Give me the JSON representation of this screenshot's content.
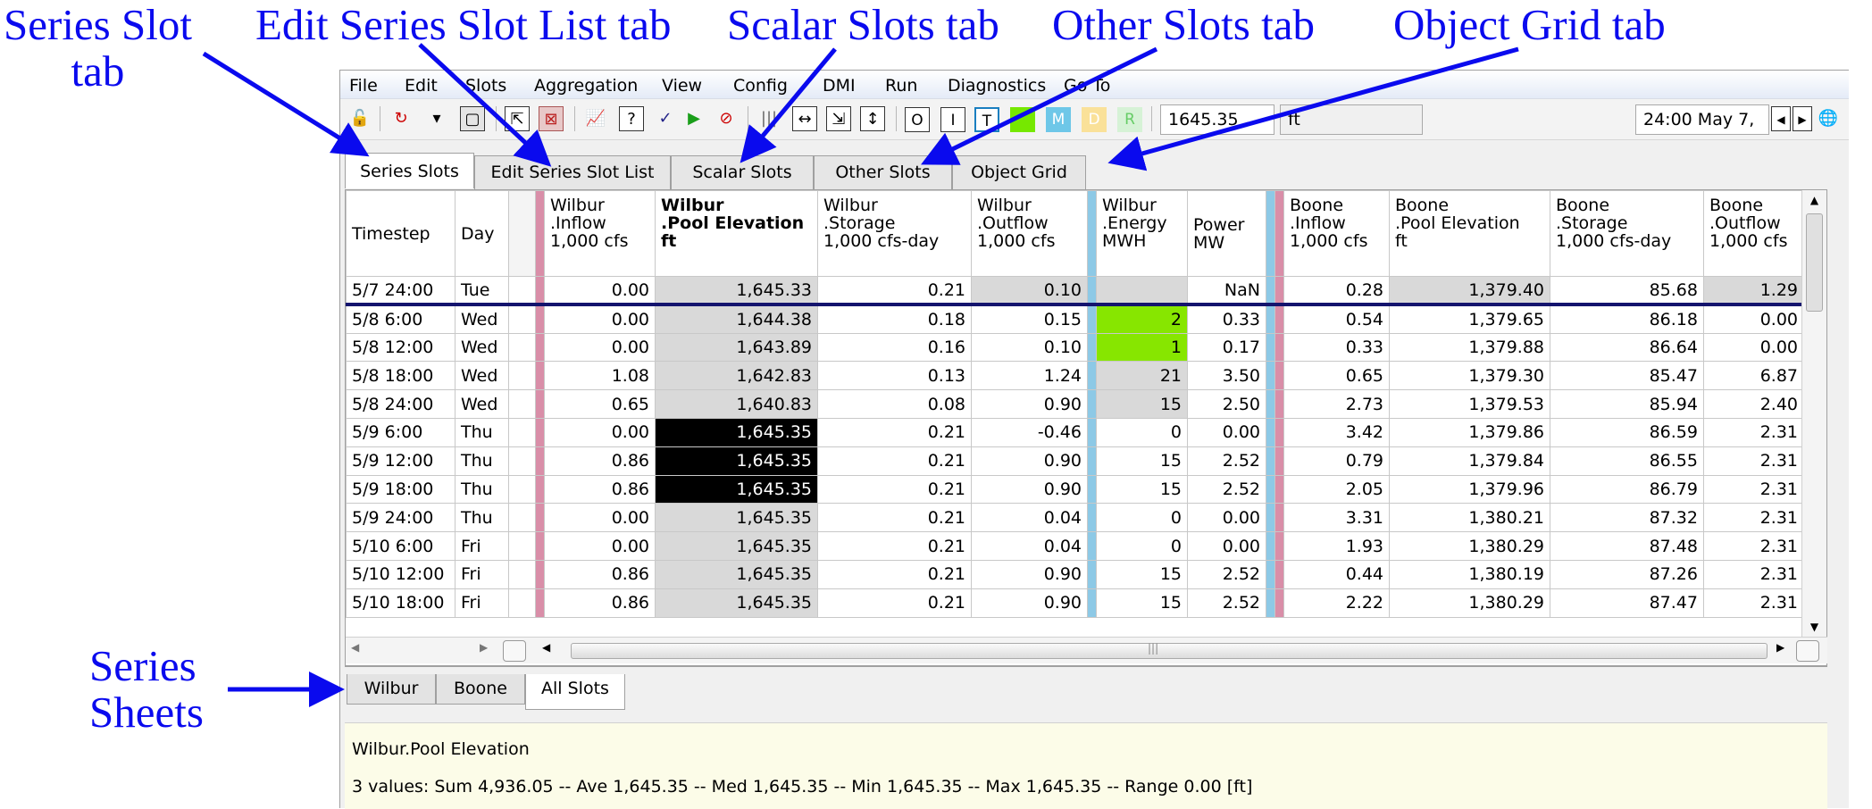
{
  "annotations": {
    "series_slot_tab": "Series Slot\ntab",
    "edit_list_tab": "Edit Series Slot List tab",
    "scalar_tab": "Scalar Slots tab",
    "other_tab": "Other Slots tab",
    "object_grid_tab": "Object Grid tab",
    "series_sheets": "Series\nSheets"
  },
  "menu": [
    "File",
    "Edit",
    "Slots",
    "Aggregation",
    "View",
    "Config",
    "DMI",
    "Run",
    "Diagnostics",
    "Go To"
  ],
  "toolbar": {
    "value": "1645.35",
    "unit": "ft",
    "date": "24:00 May 7,",
    "letters": [
      "O",
      "I",
      "T",
      "M",
      "D",
      "R"
    ]
  },
  "tabs": [
    "Series Slots",
    "Edit Series Slot List",
    "Scalar Slots",
    "Other Slots",
    "Object Grid"
  ],
  "left_headers": [
    "Timestep",
    "Day"
  ],
  "headers": [
    "Wilbur\n.Inflow\n1,000 cfs",
    "Wilbur\n.Pool Elevation\nft",
    "Wilbur\n.Storage\n1,000 cfs-day",
    "Wilbur\n.Outflow\n1,000 cfs",
    "Wilbur\n.Energy\nMWH",
    "Power\nMW",
    "Boone\n.Inflow\n1,000 cfs",
    "Boone\n.Pool Elevation\nft",
    "Boone\n.Storage\n1,000 cfs-day",
    "Boone\n.Outflow\n1,000 cfs"
  ],
  "rows": [
    {
      "t": "5/7 24:00",
      "d": "Tue",
      "v": [
        "0.00",
        "1,645.33",
        "0.21",
        "0.10",
        "",
        "NaN",
        "0.28",
        "1,379.40",
        "85.68",
        "1.29"
      ]
    },
    {
      "t": "5/8 6:00",
      "d": "Wed",
      "v": [
        "0.00",
        "1,644.38",
        "0.18",
        "0.15",
        "2",
        "0.33",
        "0.54",
        "1,379.65",
        "86.18",
        "0.00"
      ]
    },
    {
      "t": "5/8 12:00",
      "d": "Wed",
      "v": [
        "0.00",
        "1,643.89",
        "0.16",
        "0.10",
        "1",
        "0.17",
        "0.33",
        "1,379.88",
        "86.64",
        "0.00"
      ]
    },
    {
      "t": "5/8 18:00",
      "d": "Wed",
      "v": [
        "1.08",
        "1,642.83",
        "0.13",
        "1.24",
        "21",
        "3.50",
        "0.65",
        "1,379.30",
        "85.47",
        "6.87"
      ]
    },
    {
      "t": "5/8 24:00",
      "d": "Wed",
      "v": [
        "0.65",
        "1,640.83",
        "0.08",
        "0.90",
        "15",
        "2.50",
        "2.73",
        "1,379.53",
        "85.94",
        "2.40"
      ]
    },
    {
      "t": "5/9 6:00",
      "d": "Thu",
      "v": [
        "0.00",
        "1,645.35",
        "0.21",
        "-0.46",
        "0",
        "0.00",
        "3.42",
        "1,379.86",
        "86.59",
        "2.31"
      ]
    },
    {
      "t": "5/9 12:00",
      "d": "Thu",
      "v": [
        "0.86",
        "1,645.35",
        "0.21",
        "0.90",
        "15",
        "2.52",
        "0.79",
        "1,379.84",
        "86.55",
        "2.31"
      ]
    },
    {
      "t": "5/9 18:00",
      "d": "Thu",
      "v": [
        "0.86",
        "1,645.35",
        "0.21",
        "0.90",
        "15",
        "2.52",
        "2.05",
        "1,379.96",
        "86.79",
        "2.31"
      ]
    },
    {
      "t": "5/9 24:00",
      "d": "Thu",
      "v": [
        "0.00",
        "1,645.35",
        "0.21",
        "0.04",
        "0",
        "0.00",
        "3.31",
        "1,380.21",
        "87.32",
        "2.31"
      ]
    },
    {
      "t": "5/10 6:00",
      "d": "Fri",
      "v": [
        "0.00",
        "1,645.35",
        "0.21",
        "0.04",
        "0",
        "0.00",
        "1.93",
        "1,380.29",
        "87.48",
        "2.31"
      ]
    },
    {
      "t": "5/10 12:00",
      "d": "Fri",
      "v": [
        "0.86",
        "1,645.35",
        "0.21",
        "0.90",
        "15",
        "2.52",
        "0.44",
        "1,380.19",
        "87.26",
        "2.31"
      ]
    },
    {
      "t": "5/10 18:00",
      "d": "Fri",
      "v": [
        "0.86",
        "1,645.35",
        "0.21",
        "0.90",
        "15",
        "2.52",
        "2.22",
        "1,380.29",
        "87.47",
        "2.31"
      ]
    }
  ],
  "sheets": [
    "Wilbur",
    "Boone",
    "All Slots"
  ],
  "info": {
    "title": "Wilbur.Pool Elevation",
    "stats": "3 values:  Sum 4,936.05 -- Ave 1,645.35 -- Med 1,645.35 -- Min 1,645.35 -- Max 1,645.35 -- Range 0.00 [ft]"
  },
  "colors": {
    "selected": "#000000",
    "gray": "#d9d9d9",
    "green": "#87e600",
    "annotation": "#0a0aee"
  }
}
